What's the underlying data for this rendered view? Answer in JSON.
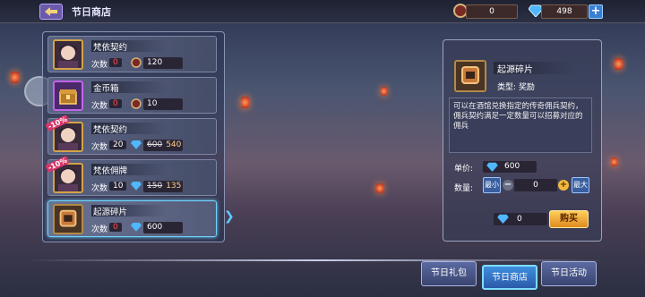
{
  "header": {
    "title": "节日商店",
    "gift_count": "0",
    "diamonds": "498",
    "plus": "+"
  },
  "items": [
    {
      "name": "梵依契约",
      "count_label": "次数",
      "count": "0",
      "price_old": "",
      "price": "120",
      "currency": "gift",
      "discount": "",
      "icon": "hero-portrait-icon",
      "selected": false
    },
    {
      "name": "金币箱",
      "count_label": "次数",
      "count": "0",
      "price_old": "",
      "price": "10",
      "currency": "gift",
      "discount": "",
      "icon": "gold-chest-icon",
      "selected": false
    },
    {
      "name": "梵依契约",
      "count_label": "次数",
      "count": "20",
      "price_old": "600",
      "price": "540",
      "currency": "diamond",
      "discount": "-10%",
      "icon": "hero-portrait-icon",
      "selected": false
    },
    {
      "name": "梵依佣牌",
      "count_label": "次数",
      "count": "10",
      "price_old": "150",
      "price": "135",
      "currency": "diamond",
      "discount": "-10%",
      "icon": "hero-portrait-icon",
      "selected": false
    },
    {
      "name": "起源碎片",
      "count_label": "次数",
      "count": "0",
      "price_old": "",
      "price": "600",
      "currency": "diamond",
      "discount": "",
      "icon": "origin-fragment-icon",
      "selected": true
    }
  ],
  "detail": {
    "name": "起源碎片",
    "type_label": "类型:",
    "type": "奖励",
    "description": "可以在酒馆兑换指定的传奇佣兵契约，佣兵契约满足一定数量可以招募对应的佣兵",
    "unit_label": "单价:",
    "unit_price": "600",
    "qty_label": "数量:",
    "min_label": "最小",
    "max_label": "最大",
    "quantity": "0",
    "total": "0",
    "buy_label": "购买"
  },
  "tabs": [
    {
      "label": "节日礼包",
      "active": false
    },
    {
      "label": "节日商店",
      "active": true
    },
    {
      "label": "节日活动",
      "active": false
    }
  ],
  "colors": {
    "accent": "#3f8fe0",
    "discount": "#d6376a",
    "buy": "#f0b93c",
    "count_zero": "#ff4d4d"
  }
}
